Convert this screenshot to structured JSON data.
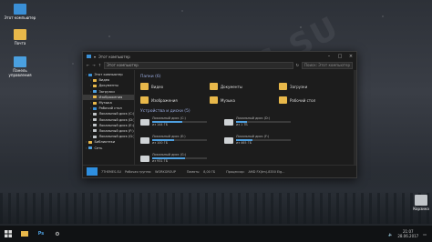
{
  "desktop": {
    "icons": [
      {
        "label": "Этот компьютер",
        "color": "#3a8fd6"
      },
      {
        "label": "Почта",
        "color": "#e8b84a"
      },
      {
        "label": "Панель управления",
        "color": "#4aa0e0"
      },
      {
        "label": "Корзина",
        "color": "#c0c4c8"
      }
    ]
  },
  "window": {
    "title": "Этот компьютер",
    "address": "Этот компьютер",
    "search_placeholder": "Поиск: Этот компьютер"
  },
  "nav": {
    "items": [
      {
        "label": "Этот компьютер",
        "color": "#3a8fd6"
      },
      {
        "label": "Видео",
        "color": "#e8b84a"
      },
      {
        "label": "Документы",
        "color": "#e8b84a"
      },
      {
        "label": "Загрузки",
        "color": "#4ea0e0"
      },
      {
        "label": "Изображения",
        "color": "#e8b84a"
      },
      {
        "label": "Музыка",
        "color": "#e8b84a"
      },
      {
        "label": "Рабочий стол",
        "color": "#3a8fd6"
      },
      {
        "label": "Локальный диск (C:)",
        "color": "#c0c4c8"
      },
      {
        "label": "Локальный диск (D:)",
        "color": "#c0c4c8"
      },
      {
        "label": "Локальный диск (E:)",
        "color": "#c0c4c8"
      },
      {
        "label": "Локальный диск (F:)",
        "color": "#c0c4c8"
      },
      {
        "label": "Локальный диск (G:)",
        "color": "#c0c4c8"
      },
      {
        "label": "Библиотеки",
        "color": "#e8b84a"
      },
      {
        "label": "Сеть",
        "color": "#4ea0e0"
      }
    ],
    "selected_index": 4
  },
  "content": {
    "folders_header": "Папки (6)",
    "folders": [
      "Видео",
      "Документы",
      "Загрузки",
      "Изображения",
      "Музыка",
      "Рабочий стол"
    ],
    "drives_header": "Устройства и диски (5)",
    "drives": [
      {
        "name": "Локальный диск (C:)",
        "free": "из 144 ГБ",
        "used": 0.55
      },
      {
        "name": "Локальный диск (D:)",
        "free": "из 1 ТБ",
        "used": 0.2
      },
      {
        "name": "Локальный диск (E:)",
        "free": "из 100 ГБ",
        "used": 0.4
      },
      {
        "name": "Локальный диск (F:)",
        "free": "из 465 ГБ",
        "used": 0.3
      },
      {
        "name": "Локальный диск (G:)",
        "free": "из 931 ГБ",
        "used": 0.6
      }
    ]
  },
  "status": {
    "name": "7THEMES-SU",
    "workgroup_label": "Рабочая группа:",
    "workgroup": "WORKGROUP",
    "memory_label": "Память:",
    "memory": "8,00 ГБ",
    "cpu_label": "Процессор:",
    "cpu": "AMD FX(tm)-8350 Eig..."
  },
  "taskbar": {
    "time": "21:07",
    "date": "28.06.2017"
  },
  "watermark": "7THEMES.SU"
}
